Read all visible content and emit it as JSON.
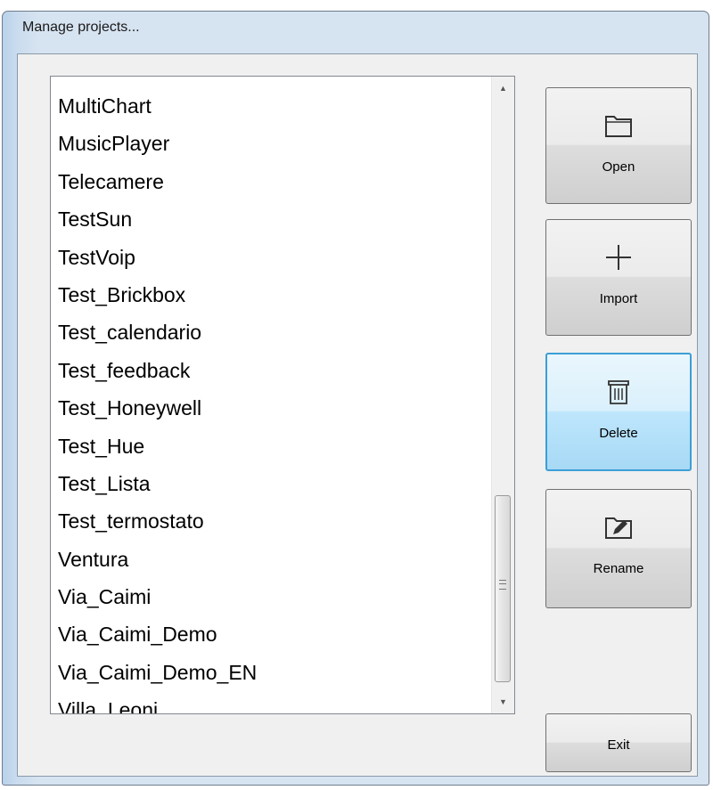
{
  "window": {
    "title": "Manage projects..."
  },
  "projects": [
    "MultiChart",
    "MusicPlayer",
    "Telecamere",
    "TestSun",
    "TestVoip",
    "Test_Brickbox",
    "Test_calendario",
    "Test_feedback",
    "Test_Honeywell",
    "Test_Hue",
    "Test_Lista",
    "Test_termostato",
    "Ventura",
    "Via_Caimi",
    "Via_Caimi_Demo",
    "Via_Caimi_Demo_EN",
    "Villa_Leoni_"
  ],
  "buttons": {
    "open": {
      "label": "Open",
      "icon": "folder-icon"
    },
    "import": {
      "label": "Import",
      "icon": "plus-icon"
    },
    "delete": {
      "label": "Delete",
      "icon": "trash-icon"
    },
    "rename": {
      "label": "Rename",
      "icon": "folder-edit-icon"
    },
    "exit": {
      "label": "Exit"
    }
  },
  "colors": {
    "focus_border": "#3c9fd6",
    "window_frame": "#d6e3f1"
  }
}
